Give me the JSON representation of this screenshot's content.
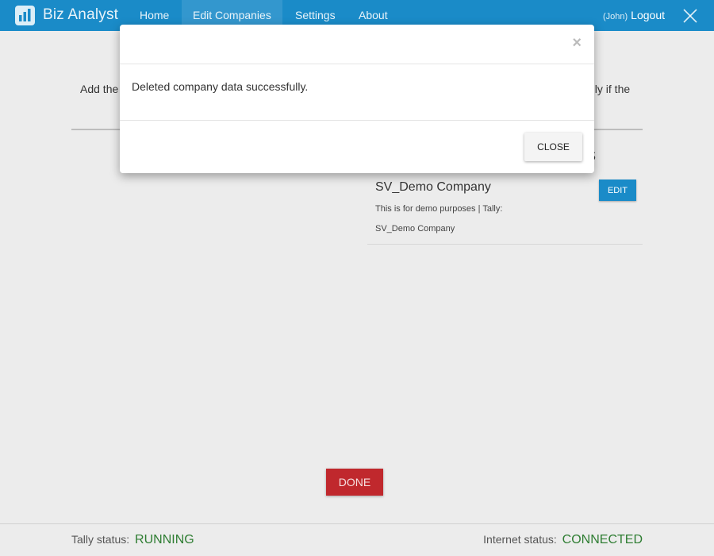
{
  "app": {
    "name": "Biz Analyst",
    "brand_color": "#1a8bc8"
  },
  "nav": {
    "items": [
      {
        "label": "Home"
      },
      {
        "label": "Edit Companies",
        "active": true
      },
      {
        "label": "Settings"
      },
      {
        "label": "About"
      }
    ],
    "user_name": "(John)",
    "logout_label": "Logout"
  },
  "page": {
    "intro_left_fragment": "Add the",
    "intro_right_fragment": "nly if the",
    "section_heading_fragment": "s",
    "companies": [
      {
        "name": "SV_Demo Company",
        "description": "This is for demo purposes | Tally: SV_Demo Company",
        "edit_label": "EDIT"
      }
    ],
    "done_label": "DONE",
    "done_color": "#c0282d"
  },
  "status": {
    "tally_label": "Tally status:",
    "tally_value": "RUNNING",
    "internet_label": "Internet status:",
    "internet_value": "CONNECTED",
    "ok_color": "#2e7d32"
  },
  "modal": {
    "close_glyph": "×",
    "message": "Deleted company data successfully.",
    "close_label": "CLOSE"
  }
}
